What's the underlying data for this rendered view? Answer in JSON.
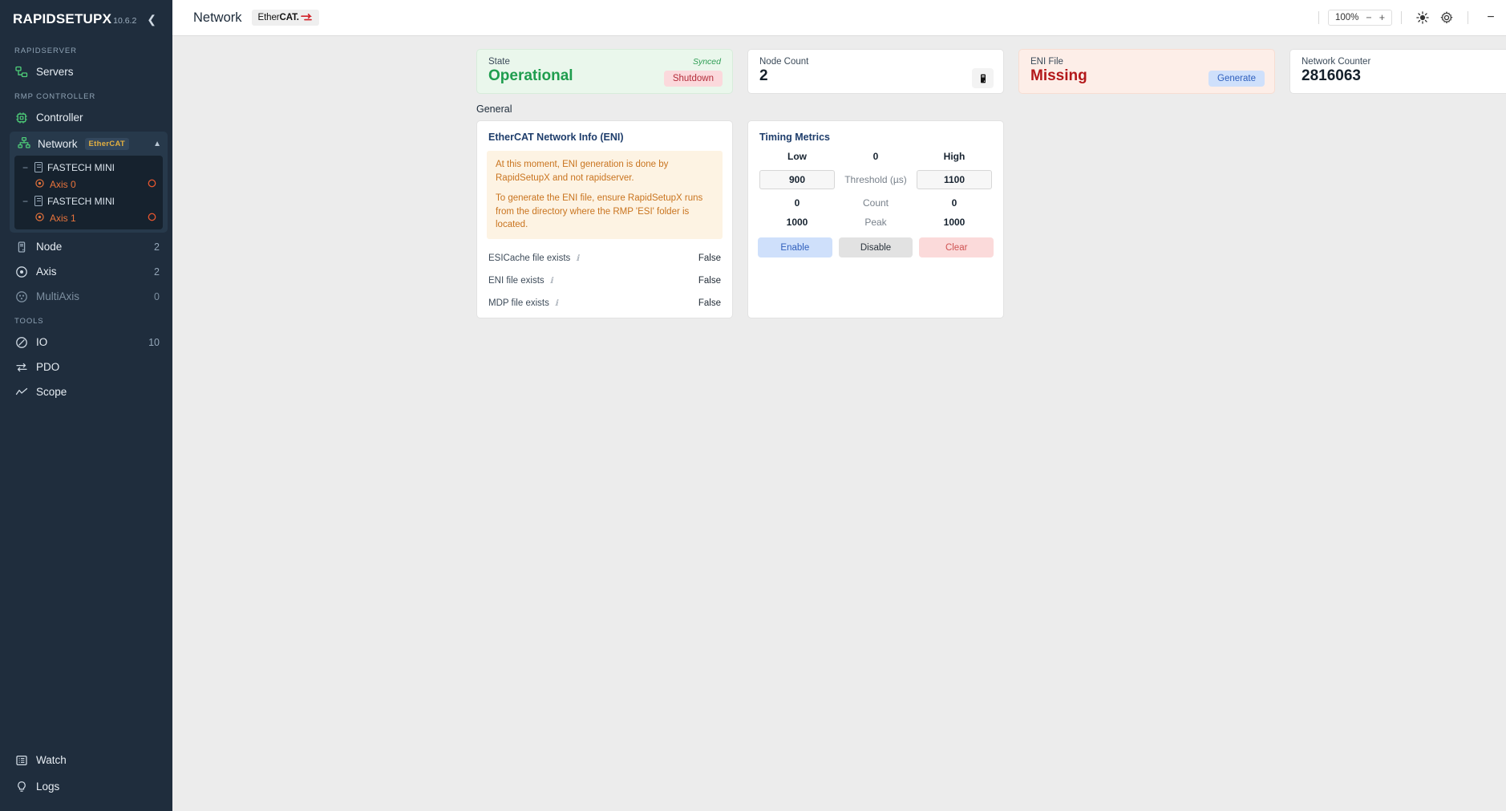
{
  "sidebar": {
    "logo": "RAPIDSETUPX",
    "version": "10.6.2",
    "collapse_icon": "chevron-left-icon",
    "sections": [
      {
        "label": "RAPIDSERVER"
      },
      {
        "label": "RMP CONTROLLER"
      },
      {
        "label": "TOOLS"
      }
    ],
    "servers": {
      "label": "Servers",
      "icon": "servers-icon"
    },
    "controller": {
      "label": "Controller",
      "icon": "chip-icon"
    },
    "network": {
      "label": "Network",
      "badge": "EtherCAT",
      "icon": "network-icon",
      "chevron": "chevron-up-icon",
      "tree": [
        {
          "type": "node",
          "label": "FASTECH MINI"
        },
        {
          "type": "axis",
          "label": "Axis 0"
        },
        {
          "type": "node",
          "label": "FASTECH MINI"
        },
        {
          "type": "axis",
          "label": "Axis 1"
        }
      ]
    },
    "items": [
      {
        "label": "Node",
        "count": "2",
        "icon": "node-icon",
        "dim": false
      },
      {
        "label": "Axis",
        "count": "2",
        "icon": "axis-icon",
        "dim": false
      },
      {
        "label": "MultiAxis",
        "count": "0",
        "icon": "multiaxis-icon",
        "dim": true
      }
    ],
    "tools": [
      {
        "label": "IO",
        "count": "10",
        "icon": "io-icon"
      },
      {
        "label": "PDO",
        "count": "",
        "icon": "pdo-icon"
      },
      {
        "label": "Scope",
        "count": "",
        "icon": "scope-icon"
      }
    ],
    "bottom": [
      {
        "label": "Watch",
        "icon": "watch-icon"
      },
      {
        "label": "Logs",
        "icon": "bulb-icon"
      }
    ]
  },
  "topbar": {
    "title": "Network",
    "ethercat_ether": "Ether",
    "ethercat_cat": "CAT.",
    "zoom": "100%",
    "zoom_out": "−",
    "zoom_in": "+",
    "brightness_icon": "brightness-icon",
    "settings_icon": "gear-icon",
    "minimize": "−",
    "maximize": "□",
    "close": "✕"
  },
  "cards": [
    {
      "label": "State",
      "value": "Operational",
      "tag": "Synced",
      "action": "Shutdown",
      "style": "green"
    },
    {
      "label": "Node Count",
      "value": "2",
      "icon": "node-icon",
      "style": "plain"
    },
    {
      "label": "ENI File",
      "value": "Missing",
      "action": "Generate",
      "style": "red"
    },
    {
      "label": "Network Counter",
      "value": "2816063",
      "icon": "timer-icon",
      "style": "plain"
    }
  ],
  "general": {
    "title": "General"
  },
  "eni_panel": {
    "title": "EtherCAT Network Info (ENI)",
    "notice_1": "At this moment, ENI generation is done by RapidSetupX and not rapidserver.",
    "notice_2": "To generate the ENI file, ensure RapidSetupX runs from the directory where the RMP 'ESI' folder is located.",
    "rows": [
      {
        "key": "ESICache file exists",
        "value": "False"
      },
      {
        "key": "ENI file exists",
        "value": "False"
      },
      {
        "key": "MDP file exists",
        "value": "False"
      }
    ]
  },
  "timing_panel": {
    "title": "Timing Metrics",
    "row_head": {
      "left": "Low",
      "mid": "0",
      "right": "High"
    },
    "row_threshold": {
      "left": "900",
      "mid": "Threshold (µs)",
      "right": "1100"
    },
    "row_count": {
      "left": "0",
      "mid": "Count",
      "right": "0"
    },
    "row_peak": {
      "left": "1000",
      "mid": "Peak",
      "right": "1000"
    },
    "buttons": {
      "enable": "Enable",
      "disable": "Disable",
      "clear": "Clear"
    }
  }
}
